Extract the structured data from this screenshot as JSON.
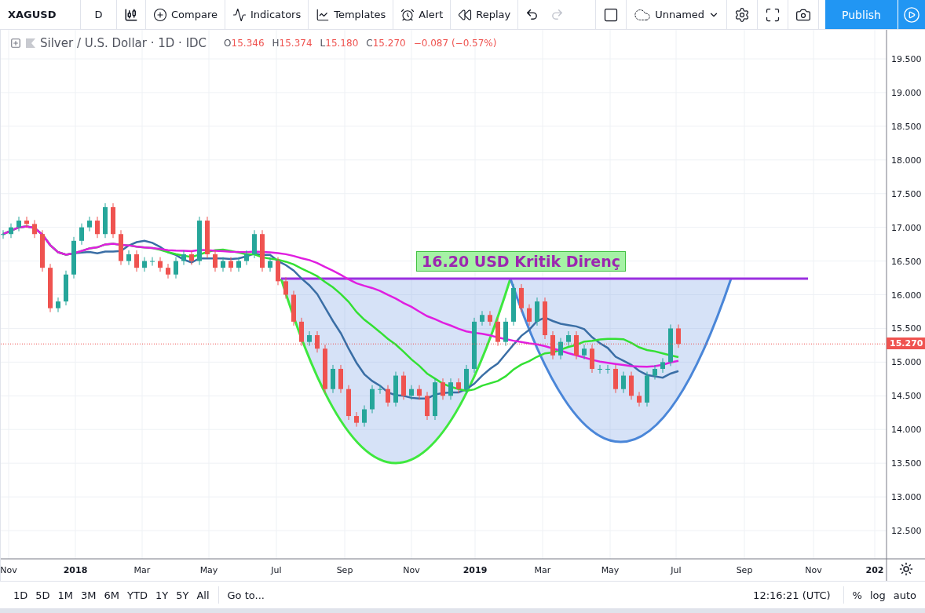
{
  "toolbar": {
    "symbol": "XAGUSD",
    "interval": "D",
    "items": [
      {
        "kind": "compare",
        "label": "Compare"
      },
      {
        "kind": "indicators",
        "label": "Indicators"
      },
      {
        "kind": "templates",
        "label": "Templates"
      },
      {
        "kind": "alert",
        "label": "Alert"
      },
      {
        "kind": "replay",
        "label": "Replay"
      }
    ],
    "history": [
      {
        "kind": "undo",
        "disabled": false
      },
      {
        "kind": "redo",
        "disabled": true
      }
    ],
    "layout_name": "Unnamed",
    "publish": "Publish"
  },
  "legend": {
    "title": "Silver / U.S. Dollar · 1D · IDC",
    "ohlc": [
      {
        "key": "O",
        "value": "15.346"
      },
      {
        "key": "H",
        "value": "15.374"
      },
      {
        "key": "L",
        "value": "15.180"
      },
      {
        "key": "C",
        "value": "15.270"
      }
    ],
    "change": "−0.087 (−0.57%)"
  },
  "chart": {
    "annotation": "16.20 USD Kritik Direnç",
    "last_price": "15.270",
    "price_axis": [
      "19.500",
      "19.000",
      "18.500",
      "18.000",
      "17.500",
      "17.000",
      "16.500",
      "16.000",
      "15.500",
      "15.000",
      "14.500",
      "14.000",
      "13.500",
      "13.000",
      "12.500"
    ],
    "time_axis": [
      {
        "label": "Nov",
        "kind": "month"
      },
      {
        "label": "2018",
        "kind": "year"
      },
      {
        "label": "Mar",
        "kind": "month"
      },
      {
        "label": "May",
        "kind": "month"
      },
      {
        "label": "Jul",
        "kind": "month"
      },
      {
        "label": "Sep",
        "kind": "month"
      },
      {
        "label": "Nov",
        "kind": "month"
      },
      {
        "label": "2019",
        "kind": "year"
      },
      {
        "label": "Mar",
        "kind": "month"
      },
      {
        "label": "May",
        "kind": "month"
      },
      {
        "label": "Jul",
        "kind": "month"
      },
      {
        "label": "Sep",
        "kind": "month"
      },
      {
        "label": "Nov",
        "kind": "month"
      },
      {
        "label": "202",
        "kind": "year"
      }
    ]
  },
  "bottom": {
    "ranges": [
      "1D",
      "5D",
      "1M",
      "3M",
      "6M",
      "YTD",
      "1Y",
      "5Y",
      "All"
    ],
    "goto": "Go to...",
    "clock": "12:16:21 (UTC)",
    "scale_options": [
      "%",
      "log",
      "auto"
    ]
  }
}
